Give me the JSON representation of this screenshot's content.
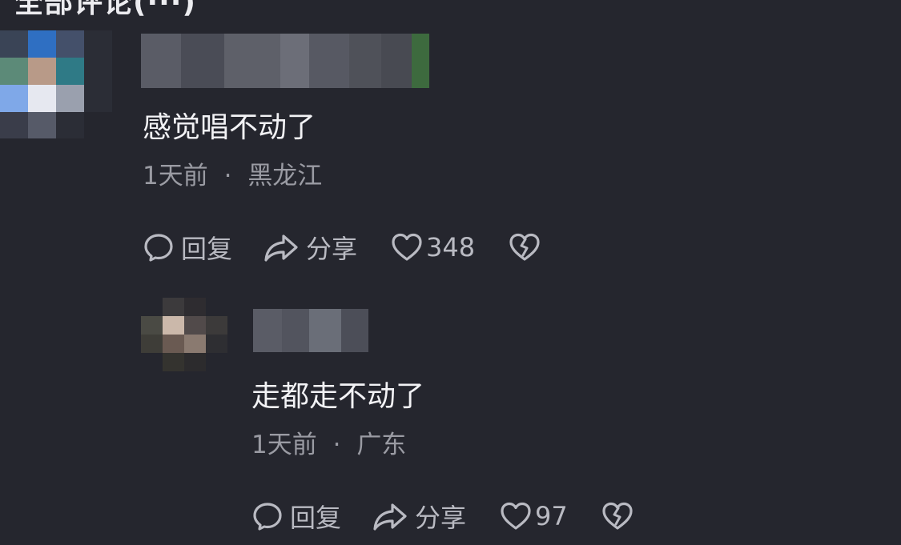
{
  "header": {
    "title_fragment": "全部评论(···)"
  },
  "comments": [
    {
      "username": "",
      "text": "感觉唱不动了",
      "time": "1天前",
      "separator": "·",
      "location": "黑龙江",
      "reply_label": "回复",
      "share_label": "分享",
      "like_count": "348",
      "icons": [
        "comment-bubble-icon",
        "share-arrow-icon",
        "heart-icon",
        "broken-heart-icon"
      ]
    },
    {
      "username": "",
      "text": "走都走不动了",
      "time": "1天前",
      "separator": "·",
      "location": "广东",
      "reply_label": "回复",
      "share_label": "分享",
      "like_count": "97",
      "icons": [
        "comment-bubble-icon",
        "share-arrow-icon",
        "heart-icon",
        "broken-heart-icon"
      ]
    }
  ],
  "colors": {
    "background": "#25262e",
    "text_primary": "#f2f2f5",
    "text_secondary": "#9a9ba3",
    "icon": "#b9bac2"
  }
}
